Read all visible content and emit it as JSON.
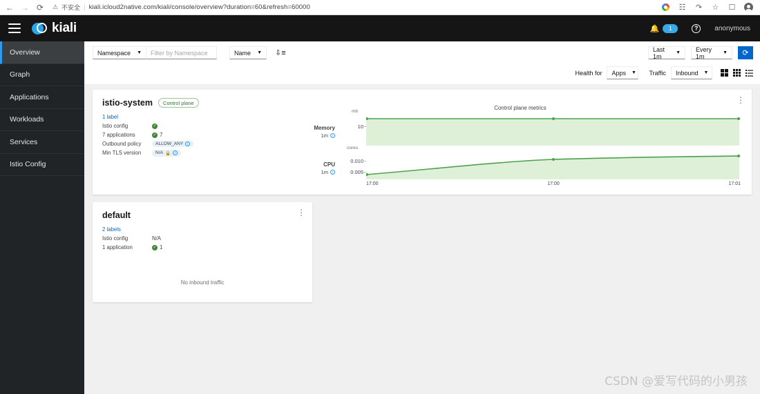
{
  "browser": {
    "back_icon": "back-arrow-icon",
    "forward_icon": "forward-arrow-icon",
    "reload_icon": "reload-icon",
    "security_label": "不安全",
    "url": "kiali.icloud2native.com/kiali/console/overview?duration=60&refresh=60000",
    "extensions": [
      "google-icon",
      "translate-icon",
      "share-icon",
      "bookmark-star-icon",
      "sidebar-icon",
      "profile-avatar-icon"
    ]
  },
  "masthead": {
    "menu_icon": "hamburger-menu-icon",
    "brand": "kiali",
    "notification_count": "1",
    "help_label": "?",
    "user": "anonymous"
  },
  "sidebar": {
    "items": [
      {
        "label": "Overview",
        "active": true
      },
      {
        "label": "Graph",
        "active": false
      },
      {
        "label": "Applications",
        "active": false
      },
      {
        "label": "Workloads",
        "active": false
      },
      {
        "label": "Services",
        "active": false
      },
      {
        "label": "Istio Config",
        "active": false
      }
    ]
  },
  "toolbar": {
    "namespace_select": "Namespace",
    "filter_placeholder": "Filter by Namespace",
    "filter_value": "",
    "name_select": "Name",
    "sort_icon": "sort-ascending-icon",
    "last_select": "Last 1m",
    "every_select": "Every 1m",
    "refresh_icon": "refresh-icon"
  },
  "toolbar2": {
    "health_label": "Health for",
    "health_select": "Apps",
    "traffic_label": "Traffic",
    "traffic_select": "Inbound",
    "view_icons": [
      "grid-large-view-icon",
      "grid-compact-view-icon",
      "list-view-icon"
    ]
  },
  "cards": [
    {
      "title": "istio-system",
      "badge": "Control plane",
      "labels_link": "1 label",
      "rows": [
        {
          "key": "Istio config",
          "type": "check",
          "value": ""
        },
        {
          "key": "7 applications",
          "type": "check-num",
          "value": "7"
        },
        {
          "key": "Outbound policy",
          "type": "pill",
          "value": "ALLOW_ANY"
        },
        {
          "key": "Min TLS version",
          "type": "pill-lock",
          "value": "N/A"
        }
      ],
      "kebab_icon": "card-menu-icon"
    },
    {
      "title": "default",
      "labels_link": "2 labels",
      "rows": [
        {
          "key": "Istio config",
          "type": "text",
          "value": "N/A"
        },
        {
          "key": "1 application",
          "type": "check-num",
          "value": "1"
        }
      ],
      "empty_state": "No inbound traffic",
      "kebab_icon": "card-menu-icon"
    }
  ],
  "chart_data": {
    "type": "area",
    "title": "Control plane metrics",
    "x": [
      "17:00",
      "17:00",
      "17:01"
    ],
    "xlabel": "",
    "grid": false,
    "legend": "none",
    "panels": [
      {
        "name": "Memory",
        "sublabel": "1m",
        "unit": "mb",
        "yticks": [
          "10"
        ],
        "ylim": [
          0,
          14
        ],
        "values": [
          10,
          10,
          10
        ],
        "color": "#4aa24a",
        "fill": "#dff0d8"
      },
      {
        "name": "CPU",
        "sublabel": "1m",
        "unit": "cores",
        "yticks": [
          "0.010",
          "0.005"
        ],
        "ylim": [
          0,
          0.013
        ],
        "values": [
          0.0035,
          0.0095,
          0.0102
        ],
        "color": "#4aa24a",
        "fill": "#dff0d8"
      }
    ]
  },
  "watermark": "CSDN @爱写代码的小男孩",
  "colors": {
    "accent": "#0066cc",
    "brand": "#2aa5e8",
    "success": "#3e8635",
    "masthead": "#151515",
    "sidebar": "#212427"
  }
}
